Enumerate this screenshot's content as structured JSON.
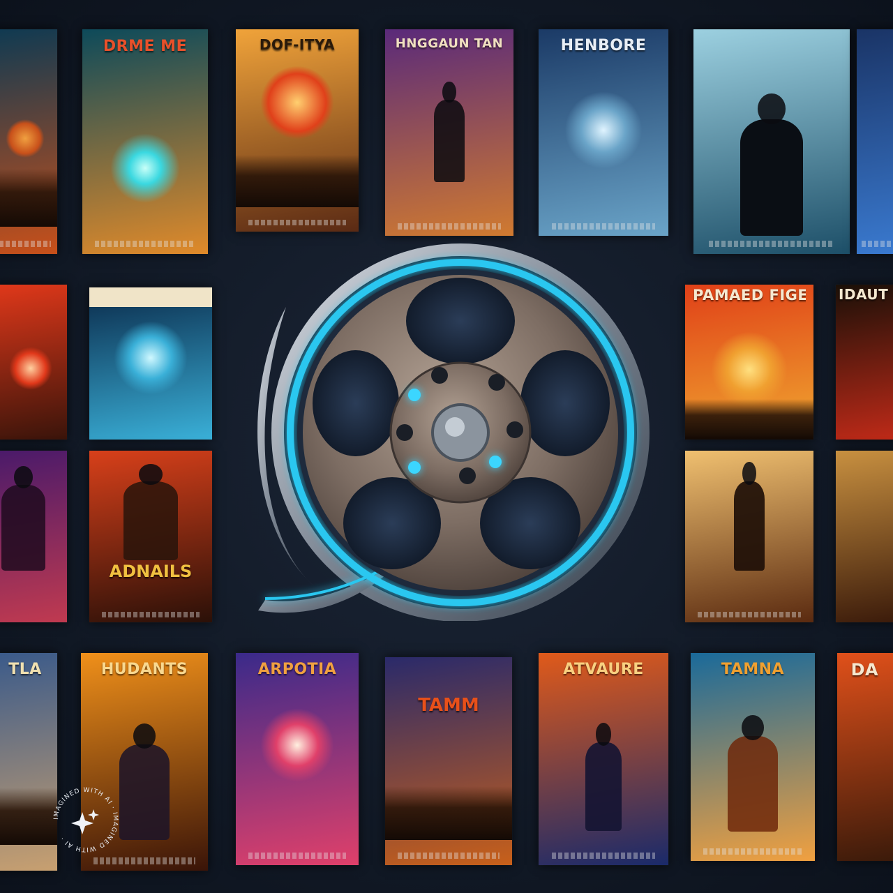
{
  "colors": {
    "background": "#121a27",
    "reel_glow": "#29c7f0",
    "reel_metal": "#8a7a70",
    "reel_dark": "#1e2a3c"
  },
  "posters": {
    "p01": {
      "title": "",
      "subtitle": "",
      "colors": [
        "#0f3a52",
        "#c8501a"
      ]
    },
    "p02": {
      "title": "DRME ME",
      "subtitle": "",
      "colors": [
        "#0d4a5a",
        "#e08a2a"
      ]
    },
    "p03": {
      "title": "DOF-ITYA",
      "subtitle": "",
      "colors": [
        "#f0a33a",
        "#5a2a14"
      ]
    },
    "p04": {
      "title": "HNGGAUN TAN",
      "subtitle": "",
      "colors": [
        "#5a2a7a",
        "#d07a30"
      ]
    },
    "p05": {
      "title": "HENBORE",
      "subtitle": "",
      "colors": [
        "#1b3a66",
        "#6aa4c8"
      ]
    },
    "p06": {
      "title": "",
      "subtitle": "",
      "colors": [
        "#9cd0e0",
        "#1d4f68"
      ]
    },
    "p07": {
      "title": "",
      "subtitle": "",
      "colors": [
        "#1a3466",
        "#3a7ad0"
      ]
    },
    "p08": {
      "title": "",
      "subtitle": "",
      "colors": [
        "#e0381a",
        "#3a140a"
      ]
    },
    "p09": {
      "title": "",
      "subtitle": "",
      "colors": [
        "#0a2a4a",
        "#3ab0d8"
      ]
    },
    "p10": {
      "title": "PAMAED FIGEE",
      "subtitle": "",
      "colors": [
        "#e04018",
        "#f0a830"
      ]
    },
    "p11": {
      "title": "IDAUT",
      "subtitle": "",
      "colors": [
        "#1a1008",
        "#c02a18"
      ]
    },
    "p12": {
      "title": "",
      "subtitle": "",
      "colors": [
        "#4a1a6a",
        "#c03a50"
      ]
    },
    "p13": {
      "title": "",
      "subtitle": "ADNAILS",
      "colors": [
        "#d8401a",
        "#2a1008"
      ]
    },
    "p14": {
      "title": "",
      "subtitle": "",
      "colors": [
        "#f0c070",
        "#5a2a10"
      ]
    },
    "p15": {
      "title": "",
      "subtitle": "",
      "colors": [
        "#c89040",
        "#3a1a0a"
      ]
    },
    "p16": {
      "title": "TLA",
      "subtitle": "",
      "colors": [
        "#3a5a8a",
        "#c8a070"
      ]
    },
    "p17": {
      "title": "HUDANTS",
      "subtitle": "",
      "colors": [
        "#f0901a",
        "#3a1408"
      ]
    },
    "p18": {
      "title": "ARPOTIA",
      "subtitle": "",
      "colors": [
        "#3a2a8a",
        "#e0406a"
      ]
    },
    "p19": {
      "title": "",
      "subtitle": "TAMM",
      "colors": [
        "#2a2a6a",
        "#c8601a"
      ]
    },
    "p20": {
      "title": "ATVAURE",
      "subtitle": "",
      "colors": [
        "#e05a1a",
        "#1a2a6a"
      ]
    },
    "p21": {
      "title": "TAMNA",
      "subtitle": "",
      "colors": [
        "#1a6a9a",
        "#f0a040"
      ]
    },
    "p22": {
      "title": "DA",
      "subtitle": "",
      "colors": [
        "#e0501a",
        "#3a1a0a"
      ]
    }
  },
  "badge": {
    "text": "IMAGINED WITH AI · IMAGINED WITH AI ·"
  }
}
